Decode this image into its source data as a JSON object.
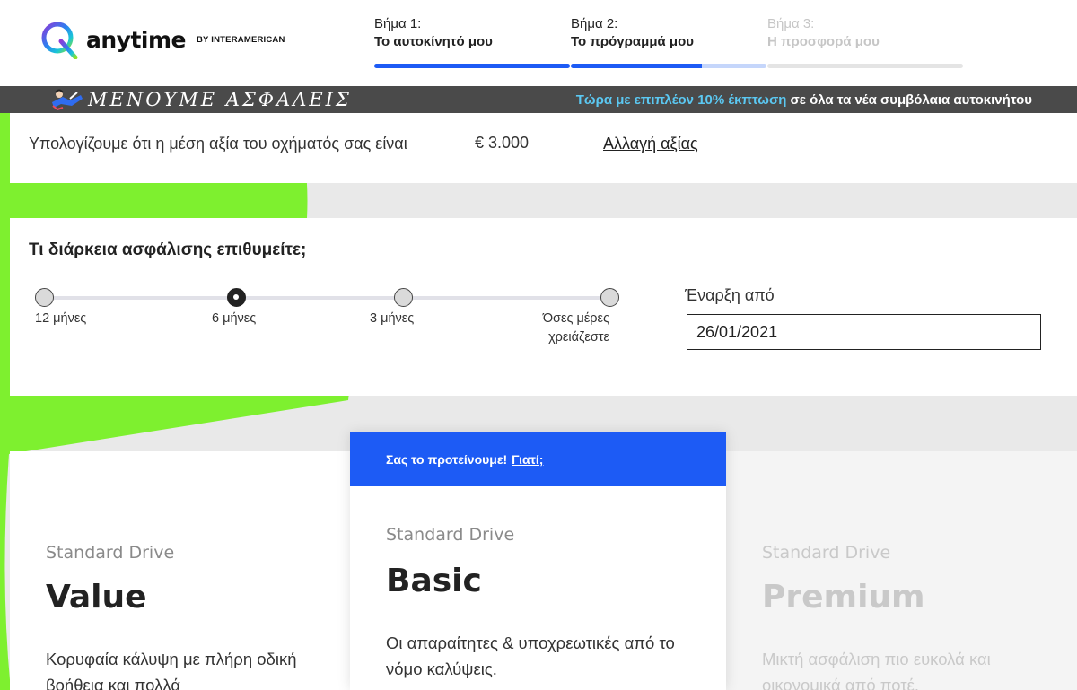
{
  "brand": {
    "name": "anytime",
    "by": "BY INTERAMERICAN"
  },
  "steps": [
    {
      "num": "Βήμα 1:",
      "name": "Το αυτοκίνητό μου",
      "progress": 1.0
    },
    {
      "num": "Βήμα 2:",
      "name": "Το πρόγραμμά μου",
      "progress": 0.67
    },
    {
      "num": "Βήμα 3:",
      "name": "Η προσφορά μου",
      "progress": 0
    }
  ],
  "promo": {
    "slogan": "ΜΕΝΟΥΜΕ ΑΣΦΑΛΕΙΣ",
    "highlight": "Τώρα με επιπλέον 10% έκπτωση",
    "rest": " σε όλα τα νέα συμβόλαια αυτοκινήτου"
  },
  "vehicle_value": {
    "text": "Υπολογίζουμε ότι η μέση αξία του οχήματός σας είναι",
    "amount": "€ 3.000",
    "change_link": "Αλλαγή αξίας"
  },
  "duration": {
    "question": "Τι διάρκεια ασφάλισης επιθυμείτε;",
    "options": [
      "12 μήνες",
      "6 μήνες",
      "3 μήνες"
    ],
    "option_last_line1": "Όσες μέρες",
    "option_last_line2": "χρειάζεστε",
    "selected": "6 μήνες",
    "start_label": "Έναρξη από",
    "start_value": "26/01/2021"
  },
  "recommend": {
    "text": "Σας το προτείνουμε!",
    "why": "Γιατί;"
  },
  "plans": [
    {
      "sub": "Standard Drive",
      "name": "Value",
      "desc": "Κορυφαία κάλυψη με πλήρη οδική βοήθεια και πολλά"
    },
    {
      "sub": "Standard Drive",
      "name": "Basic",
      "desc": "Οι απαραίτητες & υποχρεωτικές από το νόμο καλύψεις."
    },
    {
      "sub": "Standard Drive",
      "name": "Premium",
      "desc": "Μικτή ασφάλιση πιο ευκολά και οικονομικά από ποτέ."
    }
  ],
  "colors": {
    "accent": "#1d5bf5",
    "green": "#7ef02f",
    "promo_bg": "#4a4a4a",
    "promo_highlight": "#5bc8f2"
  }
}
